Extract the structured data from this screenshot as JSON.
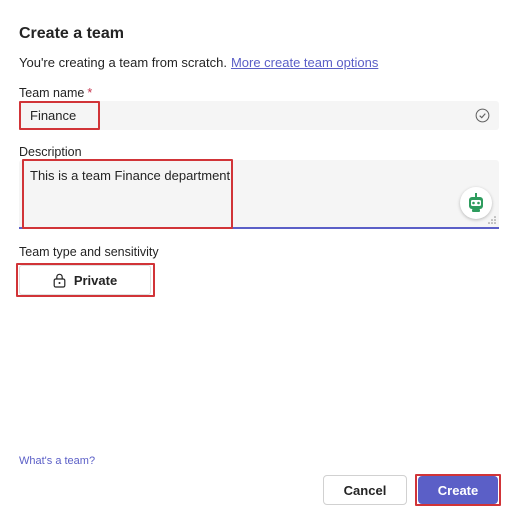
{
  "dialog": {
    "title": "Create a team",
    "subtitle": "You're creating a team from scratch.",
    "options_link": "More create team options"
  },
  "team_name": {
    "label": "Team name",
    "required_mark": "*",
    "value": "Finance",
    "validation_icon": "check-circle-icon"
  },
  "description": {
    "label": "Description",
    "value": "This is a team Finance department",
    "assistant_icon": "bot-icon"
  },
  "team_type": {
    "label": "Team type and sensitivity",
    "selected_value": "Private",
    "icon": "lock-icon"
  },
  "footer": {
    "help_link": "What's a team?",
    "cancel_label": "Cancel",
    "create_label": "Create"
  },
  "colors": {
    "accent": "#5b5fc7",
    "highlight_box": "#d13438",
    "required": "#c4314b"
  }
}
